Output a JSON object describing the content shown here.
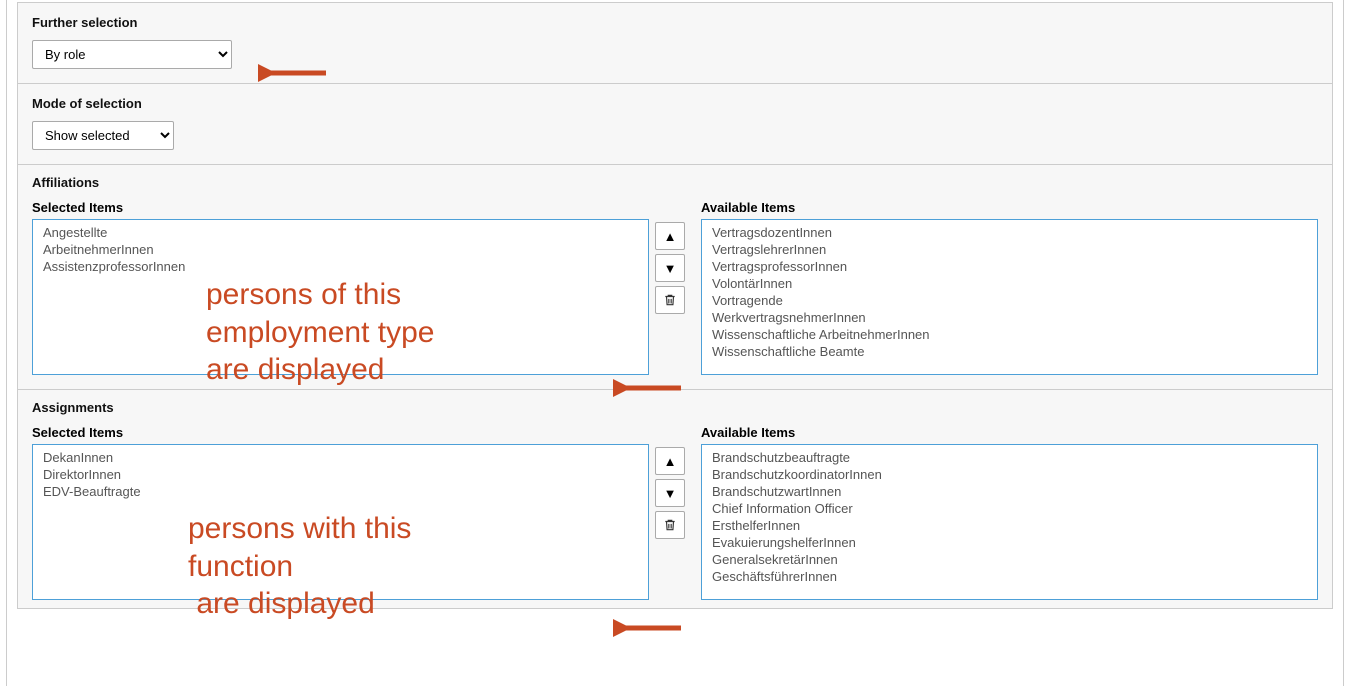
{
  "further_selection": {
    "label": "Further selection",
    "value": "By role"
  },
  "mode_of_selection": {
    "label": "Mode of selection",
    "value": "Show selected"
  },
  "affiliations": {
    "title": "Affiliations",
    "selected_label": "Selected Items",
    "available_label": "Available Items",
    "selected": [
      "Angestellte",
      "ArbeitnehmerInnen",
      "AssistenzprofessorInnen"
    ],
    "available": [
      "VertragsdozentInnen",
      "VertragslehrerInnen",
      "VertragsprofessorInnen",
      "VolontärInnen",
      "Vortragende",
      "WerkvertragsnehmerInnen",
      "Wissenschaftliche ArbeitnehmerInnen",
      "Wissenschaftliche Beamte"
    ]
  },
  "assignments": {
    "title": "Assignments",
    "selected_label": "Selected Items",
    "available_label": "Available Items",
    "selected": [
      "DekanInnen",
      "DirektorInnen",
      "EDV-Beauftragte"
    ],
    "available": [
      "Brandschutzbeauftragte",
      "BrandschutzkoordinatorInnen",
      "BrandschutzwartInnen",
      "Chief Information Officer",
      "ErsthelferInnen",
      "EvakuierungshelferInnen",
      "GeneralsekretärInnen",
      "GeschäftsführerInnen"
    ]
  },
  "annotations": {
    "arrow1_target": "further-selection-select",
    "note1": "persons of this employment type are displayed",
    "note2": "persons with this function\n are displayed"
  },
  "colors": {
    "accent_orange": "#c94a23",
    "listbox_border": "#4da0d8"
  }
}
